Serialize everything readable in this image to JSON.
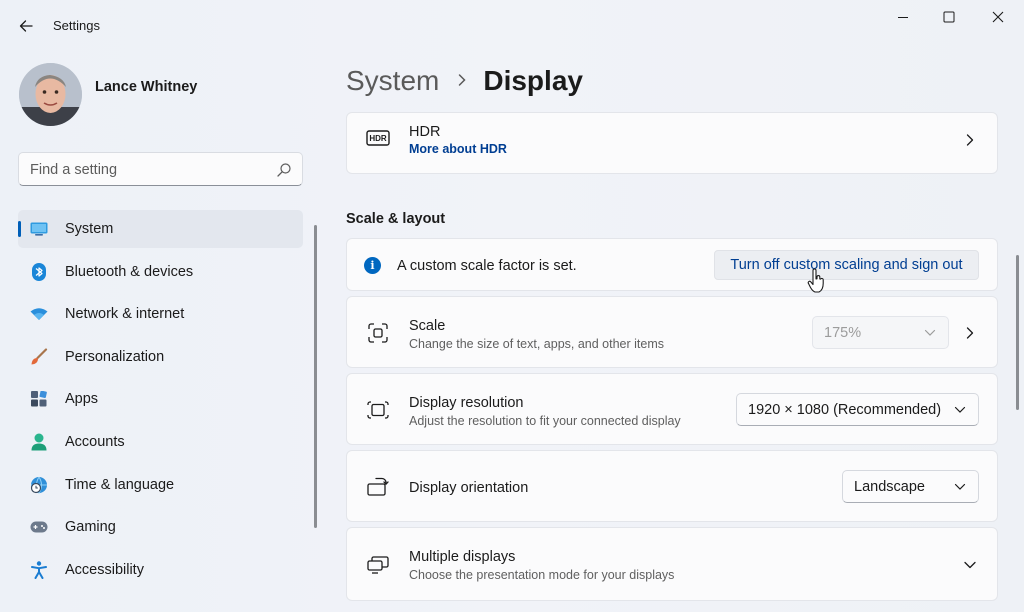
{
  "window": {
    "title": "Settings"
  },
  "user": {
    "name": "Lance Whitney"
  },
  "search": {
    "placeholder": "Find a setting"
  },
  "nav": [
    {
      "label": "System",
      "icon": "monitor-icon",
      "active": true
    },
    {
      "label": "Bluetooth & devices",
      "icon": "bluetooth-icon"
    },
    {
      "label": "Network & internet",
      "icon": "wifi-icon"
    },
    {
      "label": "Personalization",
      "icon": "paintbrush-icon"
    },
    {
      "label": "Apps",
      "icon": "apps-icon"
    },
    {
      "label": "Accounts",
      "icon": "person-icon"
    },
    {
      "label": "Time & language",
      "icon": "globe-clock-icon"
    },
    {
      "label": "Gaming",
      "icon": "gamepad-icon"
    },
    {
      "label": "Accessibility",
      "icon": "accessibility-icon"
    }
  ],
  "breadcrumb": {
    "parent": "System",
    "current": "Display"
  },
  "hdr": {
    "title": "HDR",
    "link": "More about HDR"
  },
  "section": {
    "title": "Scale & layout"
  },
  "info": {
    "text": "A custom scale factor is set.",
    "button": "Turn off custom scaling and sign out"
  },
  "scale": {
    "title": "Scale",
    "subtitle": "Change the size of text, apps, and other items",
    "value": "175%"
  },
  "resolution": {
    "title": "Display resolution",
    "subtitle": "Adjust the resolution to fit your connected display",
    "value": "1920 × 1080 (Recommended)"
  },
  "orientation": {
    "title": "Display orientation",
    "value": "Landscape"
  },
  "multiple": {
    "title": "Multiple displays",
    "subtitle": "Choose the presentation mode for your displays"
  },
  "colors": {
    "accent": "#005fb8",
    "link": "#003e92"
  }
}
